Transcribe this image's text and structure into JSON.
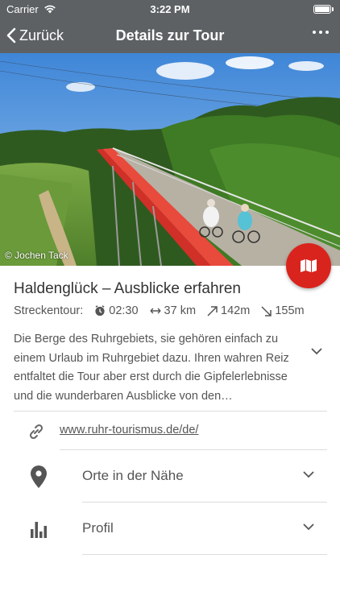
{
  "status_bar": {
    "carrier": "Carrier",
    "time": "3:22 PM"
  },
  "nav": {
    "back_label": "Zurück",
    "title": "Details zur Tour"
  },
  "hero": {
    "photo_credit": "© Jochen Tack"
  },
  "tour": {
    "title": "Haldenglück – Ausblicke erfahren",
    "type_label": "Streckentour:",
    "duration": "02:30",
    "distance": "37 km",
    "ascent": "142m",
    "descent": "155m",
    "description_lines": [
      "Die Berge des Ruhrgebiets, sie gehören einfach zu",
      "einem Urlaub im Ruhrgebiet dazu. Ihren wahren Reiz",
      "entfaltet die Tour aber erst durch die Gipfelerlebnisse",
      "und die wunderbaren Ausblicke von den…"
    ]
  },
  "link": {
    "url": "www.ruhr-tourismus.de/de/"
  },
  "rows": [
    {
      "label": "Orte in der Nähe",
      "icon": "location-pin-icon"
    },
    {
      "label": "Profil",
      "icon": "bar-chart-icon"
    }
  ],
  "colors": {
    "bar_bg": "#5d6164",
    "accent_red": "#d9241d",
    "text": "#555555"
  }
}
